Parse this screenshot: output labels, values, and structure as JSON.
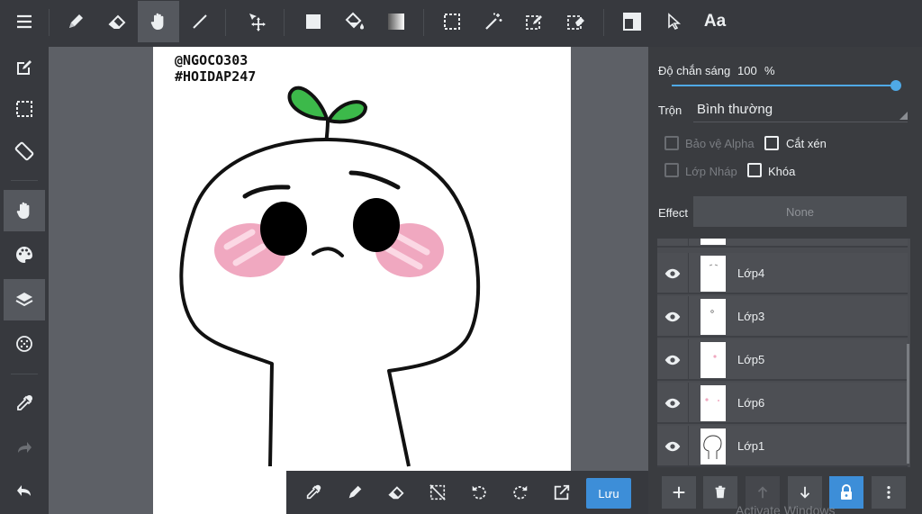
{
  "canvas": {
    "watermark_line1": "@NGOCO303",
    "watermark_line2": "#HOIDAP247"
  },
  "top_toolbar": {
    "tools": [
      "menu-icon",
      "pen-icon",
      "eraser-icon",
      "hand-icon",
      "line-icon",
      "move-icon",
      "fill-rect-icon",
      "bucket-icon",
      "gradient-icon",
      "select-rect-icon",
      "magic-wand-icon",
      "select-pen-icon",
      "select-eraser-icon",
      "panel-layout-icon",
      "cursor-icon",
      "text-icon"
    ],
    "active_tool": "hand-icon",
    "text_tool_label": "Aa"
  },
  "left_toolbar": {
    "tools": [
      "edit-icon",
      "selection-icon",
      "rotate-screen-icon",
      "hand-icon",
      "palette-icon",
      "layers-icon",
      "brush-settings-icon",
      "eyedropper-icon",
      "redo-icon",
      "undo-icon"
    ]
  },
  "bottom_toolbar": {
    "tools": [
      "eyedropper-icon",
      "pen-icon",
      "eraser-icon",
      "deselect-icon",
      "rotate-left-icon",
      "rotate-right-icon",
      "export-icon"
    ],
    "save_label": "Lưu"
  },
  "layer_panel": {
    "opacity_label": "Độ chắn sáng",
    "opacity_value": "100",
    "opacity_unit": "%",
    "opacity_fraction": 1.0,
    "blend_label": "Trộn",
    "blend_value": "Bình thường",
    "protect_alpha_label": "Bảo vệ Alpha",
    "clipping_label": "Cắt xén",
    "draft_layer_label": "Lớp Nháp",
    "lock_label": "Khóa",
    "effect_label": "Effect",
    "effect_value": "None",
    "layers": [
      {
        "name": "Lớp4"
      },
      {
        "name": "Lớp3"
      },
      {
        "name": "Lớp5"
      },
      {
        "name": "Lớp6"
      },
      {
        "name": "Lớp1"
      }
    ],
    "actions": [
      "add-layer-icon",
      "delete-layer-icon",
      "move-up-icon",
      "move-down-icon",
      "lock-icon",
      "more-icon"
    ]
  },
  "system": {
    "os_watermark": "Activate Windows"
  },
  "colors": {
    "accent": "#3d8ed8",
    "sprout_green": "#3cb94a",
    "blush_pink": "#f0a8c0"
  }
}
